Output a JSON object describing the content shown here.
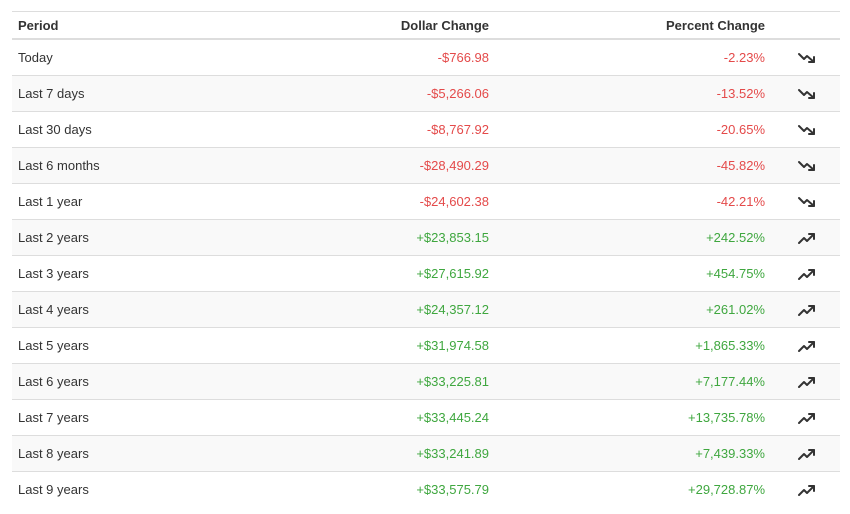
{
  "table": {
    "headers": {
      "period": "Period",
      "dollar": "Dollar Change",
      "percent": "Percent Change"
    },
    "colors": {
      "negative": "#e44a4a",
      "positive": "#3fa73f"
    },
    "rows": [
      {
        "period": "Today",
        "dollar": "-$766.98",
        "percent": "-2.23%",
        "trend": "down",
        "icon": "trending-down-icon"
      },
      {
        "period": "Last 7 days",
        "dollar": "-$5,266.06",
        "percent": "-13.52%",
        "trend": "down",
        "icon": "trending-down-icon"
      },
      {
        "period": "Last 30 days",
        "dollar": "-$8,767.92",
        "percent": "-20.65%",
        "trend": "down",
        "icon": "trending-down-icon"
      },
      {
        "period": "Last 6 months",
        "dollar": "-$28,490.29",
        "percent": "-45.82%",
        "trend": "down",
        "icon": "trending-down-icon"
      },
      {
        "period": "Last 1 year",
        "dollar": "-$24,602.38",
        "percent": "-42.21%",
        "trend": "down",
        "icon": "trending-down-icon"
      },
      {
        "period": "Last 2 years",
        "dollar": "+$23,853.15",
        "percent": "+242.52%",
        "trend": "up",
        "icon": "trending-up-icon"
      },
      {
        "period": "Last 3 years",
        "dollar": "+$27,615.92",
        "percent": "+454.75%",
        "trend": "up",
        "icon": "trending-up-icon"
      },
      {
        "period": "Last 4 years",
        "dollar": "+$24,357.12",
        "percent": "+261.02%",
        "trend": "up",
        "icon": "trending-up-icon"
      },
      {
        "period": "Last 5 years",
        "dollar": "+$31,974.58",
        "percent": "+1,865.33%",
        "trend": "up",
        "icon": "trending-up-icon"
      },
      {
        "period": "Last 6 years",
        "dollar": "+$33,225.81",
        "percent": "+7,177.44%",
        "trend": "up",
        "icon": "trending-up-icon"
      },
      {
        "period": "Last 7 years",
        "dollar": "+$33,445.24",
        "percent": "+13,735.78%",
        "trend": "up",
        "icon": "trending-up-icon"
      },
      {
        "period": "Last 8 years",
        "dollar": "+$33,241.89",
        "percent": "+7,439.33%",
        "trend": "up",
        "icon": "trending-up-icon"
      },
      {
        "period": "Last 9 years",
        "dollar": "+$33,575.79",
        "percent": "+29,728.87%",
        "trend": "up",
        "icon": "trending-up-icon"
      }
    ]
  }
}
